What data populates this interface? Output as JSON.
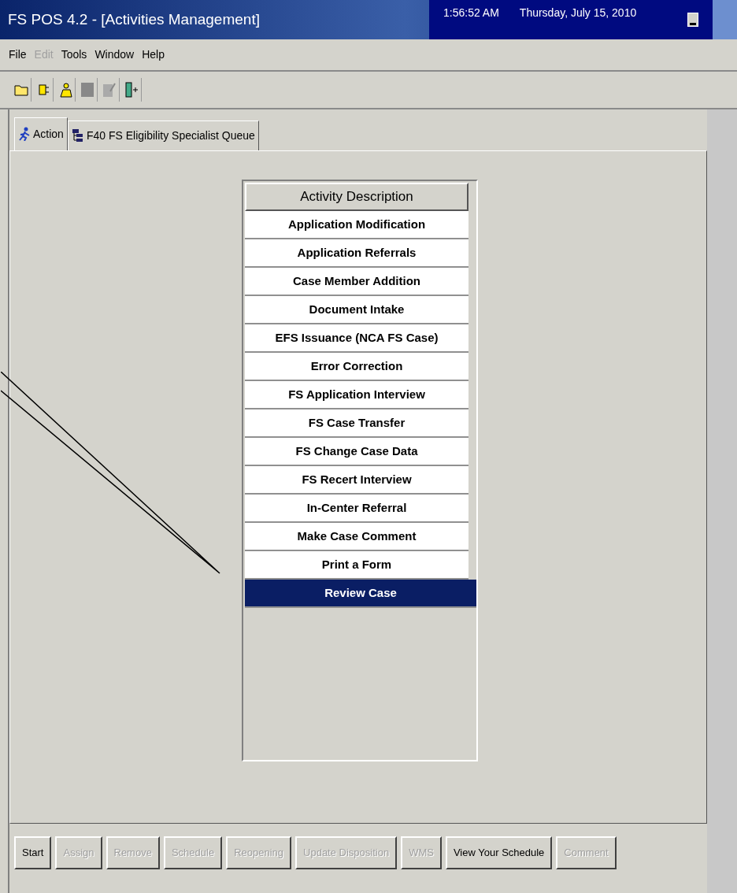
{
  "window": {
    "title": "FS POS 4.2 - [Activities Management]",
    "time": "1:56:52 AM",
    "date": "Thursday, July 15, 2010"
  },
  "menu": [
    {
      "label": "File",
      "disabled": false
    },
    {
      "label": "Edit",
      "disabled": true
    },
    {
      "label": "Tools",
      "disabled": false
    },
    {
      "label": "Window",
      "disabled": false
    },
    {
      "label": "Help",
      "disabled": false
    }
  ],
  "toolbar": [
    {
      "kind": "folder",
      "disabled": false
    },
    {
      "kind": "plug",
      "disabled": false
    },
    {
      "kind": "people",
      "disabled": false
    },
    {
      "kind": "square",
      "disabled": true
    },
    {
      "kind": "note",
      "disabled": true
    },
    {
      "kind": "exit",
      "disabled": false
    }
  ],
  "tabs": [
    {
      "label": "Action",
      "kind": "runner",
      "selected": true
    },
    {
      "label": "F40 FS Eligibility Specialist Queue",
      "kind": "tree",
      "selected": false
    }
  ],
  "activity_list": {
    "header": "Activity Description",
    "rows": [
      {
        "label": "Application Modification",
        "selected": false
      },
      {
        "label": "Application Referrals",
        "selected": false
      },
      {
        "label": "Case Member Addition",
        "selected": false
      },
      {
        "label": "Document Intake",
        "selected": false
      },
      {
        "label": "EFS Issuance (NCA FS Case)",
        "selected": false
      },
      {
        "label": "Error Correction",
        "selected": false
      },
      {
        "label": "FS Application Interview",
        "selected": false
      },
      {
        "label": "FS Case Transfer",
        "selected": false
      },
      {
        "label": "FS Change Case Data",
        "selected": false
      },
      {
        "label": "FS Recert Interview",
        "selected": false
      },
      {
        "label": "In-Center Referral",
        "selected": false
      },
      {
        "label": "Make Case Comment",
        "selected": false
      },
      {
        "label": "Print a Form",
        "selected": false
      },
      {
        "label": "Review Case",
        "selected": true
      }
    ]
  },
  "buttons": [
    {
      "label": "Start",
      "disabled": false
    },
    {
      "label": "Assign",
      "disabled": true
    },
    {
      "label": "Remove",
      "disabled": true
    },
    {
      "label": "Schedule",
      "disabled": true
    },
    {
      "label": "Reopening",
      "disabled": true
    },
    {
      "label": "Update Disposition",
      "disabled": true
    },
    {
      "label": "WMS",
      "disabled": true
    },
    {
      "label": "View Your Schedule",
      "disabled": false
    },
    {
      "label": "Comment",
      "disabled": true
    }
  ]
}
